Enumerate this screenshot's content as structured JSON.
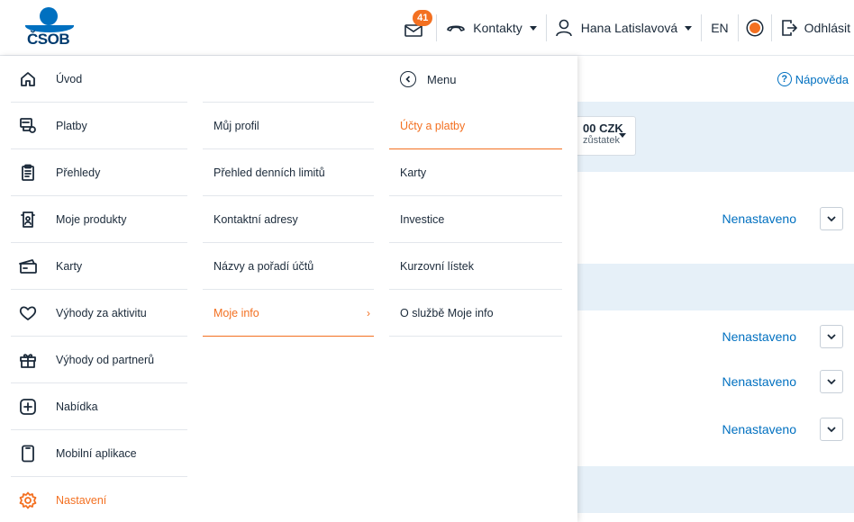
{
  "brand": {
    "logo_text": "ČSOB",
    "accent": "#f37021",
    "primary": "#0070c0"
  },
  "header": {
    "mail_badge": "41",
    "contacts_label": "Kontakty",
    "user_name": "Hana Latislavová",
    "language": "EN",
    "logout_label": "Odhlásit"
  },
  "page": {
    "help_label": "Nápověda",
    "help_glyph": "?",
    "balance_amount": "00 CZK",
    "balance_label": "zůstatek",
    "settings": [
      "Nenastaveno",
      "Nenastaveno",
      "Nenastaveno",
      "Nenastaveno"
    ]
  },
  "menu": {
    "main_items": [
      {
        "label": "Úvod",
        "icon": "home-icon"
      },
      {
        "label": "Platby",
        "icon": "payments-icon"
      },
      {
        "label": "Přehledy",
        "icon": "clipboard-icon"
      },
      {
        "label": "Moje produkty",
        "icon": "products-icon"
      },
      {
        "label": "Karty",
        "icon": "card-icon"
      },
      {
        "label": "Výhody za aktivitu",
        "icon": "heart-icon"
      },
      {
        "label": "Výhody od partnerů",
        "icon": "gift-icon"
      },
      {
        "label": "Nabídka",
        "icon": "plus-box-icon"
      },
      {
        "label": "Mobilní aplikace",
        "icon": "phone-icon"
      },
      {
        "label": "Nastavení",
        "icon": "gear-icon",
        "active": true
      }
    ],
    "settings_items": [
      {
        "label": "Můj profil"
      },
      {
        "label": "Přehled denních limitů"
      },
      {
        "label": "Kontaktní adresy"
      },
      {
        "label": "Názvy a pořadí účtů"
      },
      {
        "label": "Moje info",
        "active": true,
        "chevron": "›"
      }
    ],
    "info_back_label": "Menu",
    "info_items": [
      {
        "label": "Účty a platby",
        "active": true
      },
      {
        "label": "Karty"
      },
      {
        "label": "Investice"
      },
      {
        "label": "Kurzovní lístek"
      },
      {
        "label": "O službě Moje info"
      }
    ]
  }
}
